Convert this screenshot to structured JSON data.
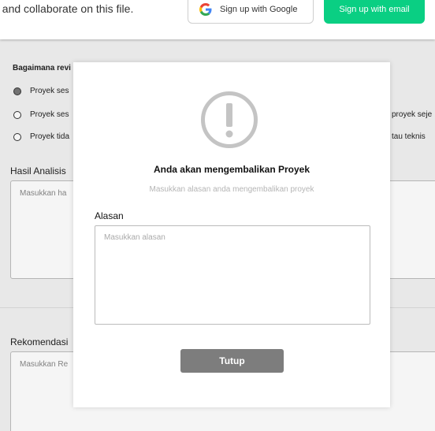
{
  "banner": {
    "text": "t and collaborate on this file.",
    "google_button": "Sign up with Google",
    "email_button": "Sign up with email",
    "accent_color": "#0acf83"
  },
  "form": {
    "question": "Bagaimana revi",
    "options": [
      {
        "label": "Proyek ses",
        "checked": true
      },
      {
        "label": "Proyek ses",
        "checked": false
      },
      {
        "label": "Proyek tida",
        "checked": false
      }
    ],
    "option_right_fragments": [
      "proyek seje",
      "tau teknis"
    ],
    "analysis_label": "Hasil Analisis",
    "analysis_placeholder": "Masukkan ha",
    "recommendation_label": "Rekomendasi",
    "recommendation_placeholder": "Masukkan Re"
  },
  "modal": {
    "icon": "exclamation-circle-icon",
    "title": "Anda akan mengembalikan Proyek",
    "subtitle": "Masukkan alasan anda mengembalikan proyek",
    "reason_label": "Alasan",
    "reason_placeholder": "Masukkan alasan",
    "close_button": "Tutup"
  }
}
